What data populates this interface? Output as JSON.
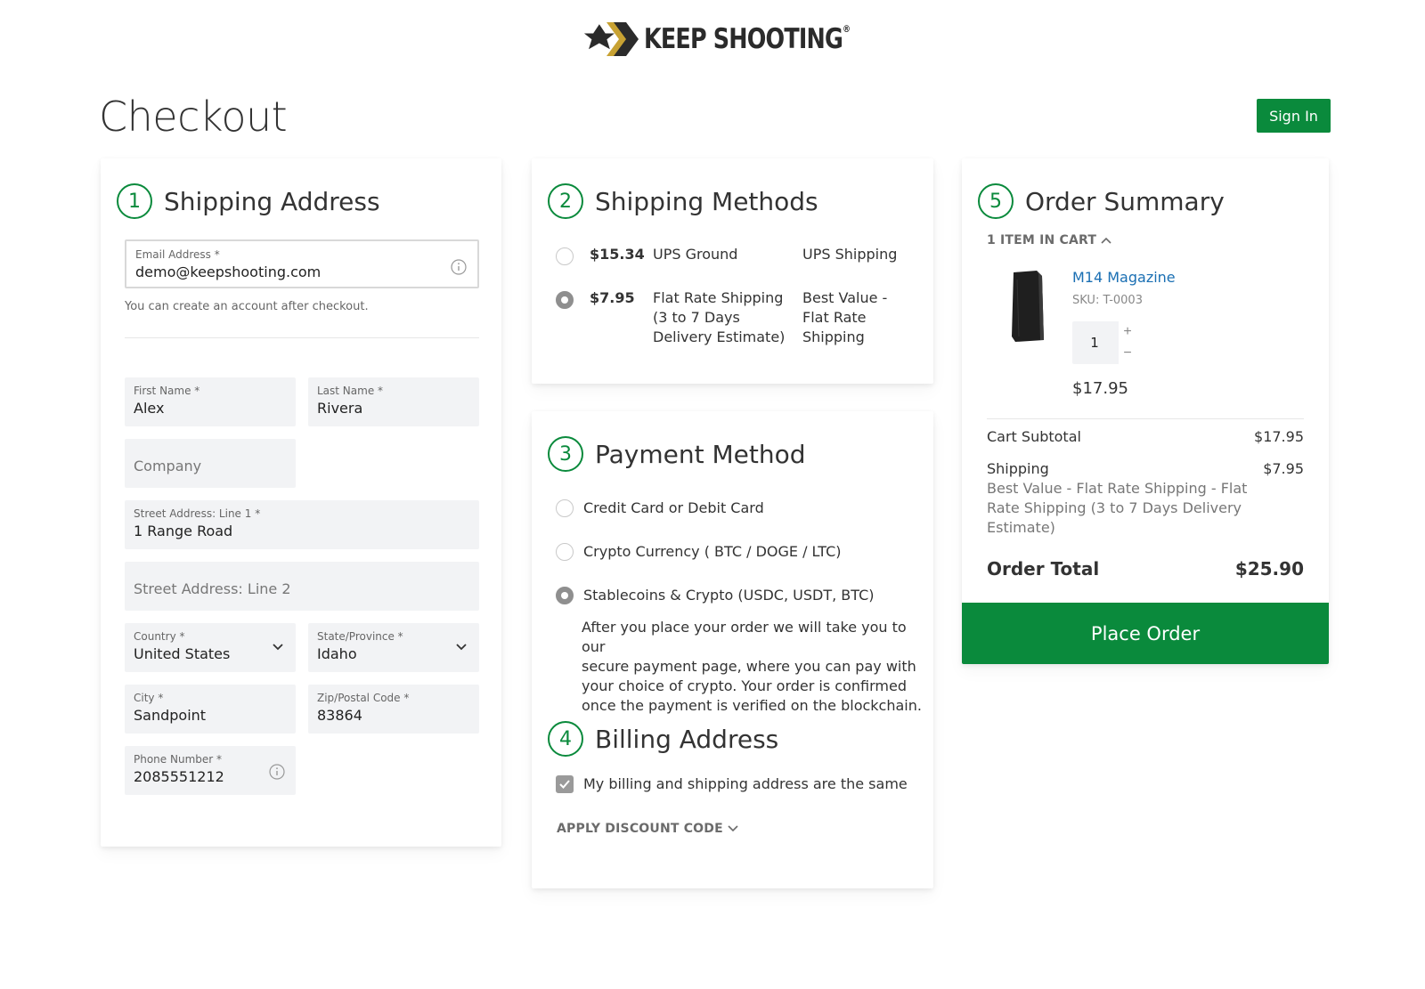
{
  "brand": {
    "name": "KEEP SHOOTING",
    "reg": "®"
  },
  "page_title": "Checkout",
  "sign_in_label": "Sign In",
  "shipping_address": {
    "step": "1",
    "title": "Shipping Address",
    "email": {
      "label": "Email Address *",
      "value": "demo@keepshooting.com"
    },
    "account_hint": "You can create an account after checkout.",
    "first_name": {
      "label": "First Name *",
      "value": "Alex"
    },
    "last_name": {
      "label": "Last Name *",
      "value": "Rivera"
    },
    "company": {
      "placeholder": "Company"
    },
    "street1": {
      "label": "Street Address: Line 1 *",
      "value": "1 Range Road"
    },
    "street2": {
      "placeholder": "Street Address: Line 2"
    },
    "country": {
      "label": "Country *",
      "value": "United States"
    },
    "state": {
      "label": "State/Province *",
      "value": "Idaho"
    },
    "city": {
      "label": "City *",
      "value": "Sandpoint"
    },
    "zip": {
      "label": "Zip/Postal Code *",
      "value": "83864"
    },
    "phone": {
      "label": "Phone Number *",
      "value": "2085551212"
    }
  },
  "shipping_methods": {
    "step": "2",
    "title": "Shipping Methods",
    "options": [
      {
        "price": "$15.34",
        "method": "UPS Ground",
        "carrier": "UPS Shipping",
        "selected": false
      },
      {
        "price": "$7.95",
        "method_lines": [
          "Flat Rate Shipping",
          "(3 to 7 Days",
          "Delivery Estimate)"
        ],
        "carrier_lines": [
          "Best Value -",
          "Flat Rate",
          "Shipping"
        ],
        "selected": true
      }
    ]
  },
  "payment_method": {
    "step": "3",
    "title": "Payment Method",
    "options": [
      {
        "label": "Credit Card or Debit Card",
        "selected": false
      },
      {
        "label": "Crypto Currency ( BTC / DOGE / LTC)",
        "selected": false
      },
      {
        "label": "Stablecoins & Crypto (USDC, USDT, BTC)",
        "selected": true
      }
    ],
    "note_lines": [
      "After you place your order we will take you to our",
      "secure payment page, where you can pay with",
      "your choice of crypto. Your order is confirmed",
      "once the payment is verified on the blockchain."
    ]
  },
  "billing_address": {
    "step": "4",
    "title": "Billing Address",
    "same_label": "My billing and shipping address are the same",
    "same_checked": true
  },
  "discount_label": "APPLY DISCOUNT CODE",
  "order_summary": {
    "step": "5",
    "title": "Order Summary",
    "items_in_cart": "1 ITEM IN CART",
    "item": {
      "name": "M14 Magazine",
      "sku": "SKU: T-0003",
      "qty": "1",
      "price": "$17.95"
    },
    "subtotal_label": "Cart Subtotal",
    "subtotal_value": "$17.95",
    "shipping_label": "Shipping",
    "shipping_value": "$7.95",
    "shipping_desc_lines": [
      "Best Value - Flat Rate Shipping - Flat",
      "Rate Shipping (3 to 7 Days Delivery",
      "Estimate)"
    ],
    "total_label": "Order Total",
    "total_value": "$25.90"
  },
  "place_order_label": "Place Order",
  "colors": {
    "brand_green": "#0a8a3c",
    "link_blue": "#1a6fb3"
  }
}
